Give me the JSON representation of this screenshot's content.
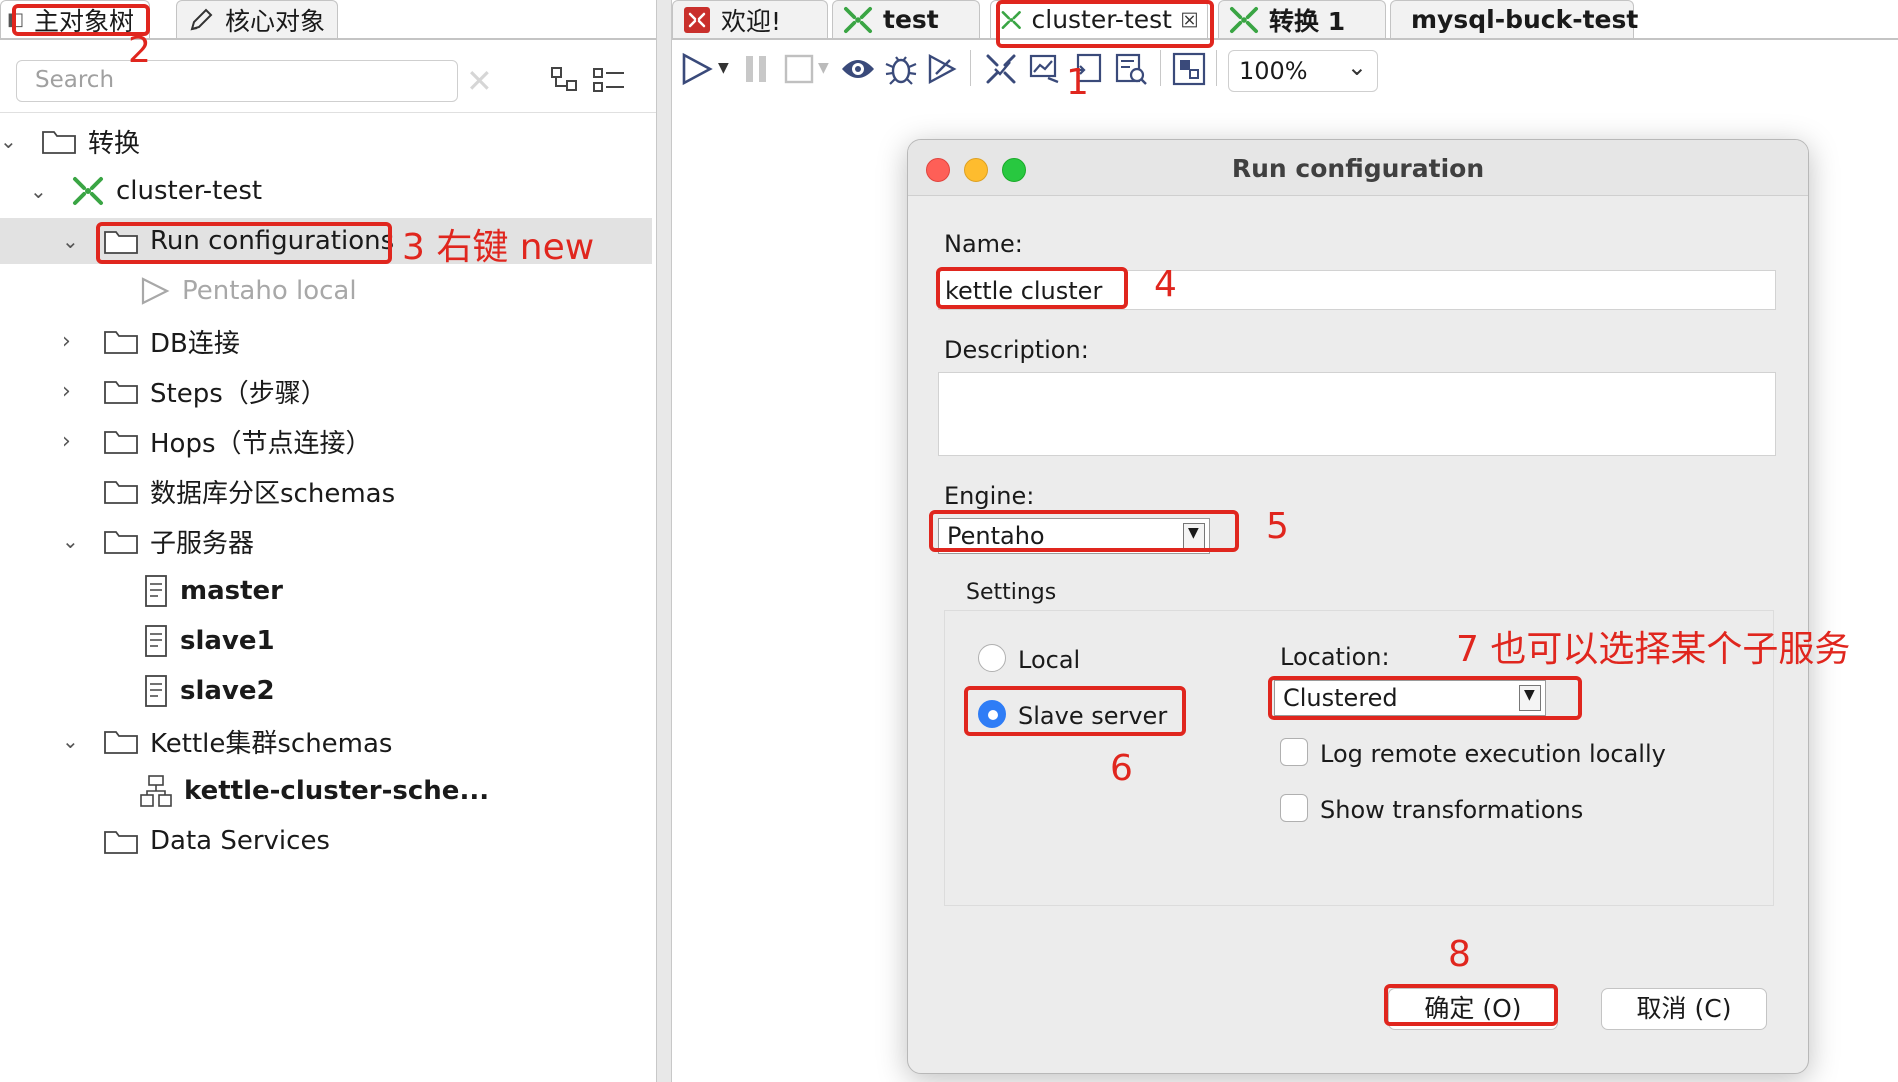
{
  "left_tabs": [
    {
      "label": "主对象树"
    },
    {
      "label": "核心对象"
    }
  ],
  "search": {
    "placeholder": "Search"
  },
  "tree": {
    "root": "转换",
    "transform": "cluster-test",
    "run_configs": "Run configurations",
    "pentaho_local": "Pentaho local",
    "db": "DB连接",
    "steps": "Steps（步骤）",
    "hops": "Hops（节点连接）",
    "partitions": "数据库分区schemas",
    "slave_servers": "子服务器",
    "master": "master",
    "slave1": "slave1",
    "slave2": "slave2",
    "cluster_schemas": "Kettle集群schemas",
    "cluster_schema_item": "kettle-cluster-sche...",
    "data_services": "Data Services"
  },
  "editor_tabs": [
    {
      "label": "欢迎!"
    },
    {
      "label": "test"
    },
    {
      "label": "cluster-test"
    },
    {
      "label": "转换 1"
    },
    {
      "label": "mysql-buck-test"
    }
  ],
  "toolbar": {
    "zoom": "100%"
  },
  "dialog": {
    "title": "Run configuration",
    "name_label": "Name:",
    "name_value": "kettle cluster",
    "description_label": "Description:",
    "engine_label": "Engine:",
    "engine_value": "Pentaho",
    "settings_label": "Settings",
    "local_label": "Local",
    "slave_label": "Slave server",
    "location_label": "Location:",
    "location_value": "Clustered",
    "log_remote_label": "Log remote execution locally",
    "show_trans_label": "Show transformations",
    "ok_button": "确定 (O)",
    "cancel_button": "取消 (C)"
  },
  "annotations": {
    "n1": "1",
    "n2": "2",
    "n3": "3 右键 new",
    "n4": "4",
    "n5": "5",
    "n6": "6",
    "n7": "7 也可以选择某个子服务",
    "n8": "8"
  },
  "colors": {
    "annotation": "#e0261e",
    "accent": "#2f7df6",
    "transform_icon": "#3aa544"
  }
}
